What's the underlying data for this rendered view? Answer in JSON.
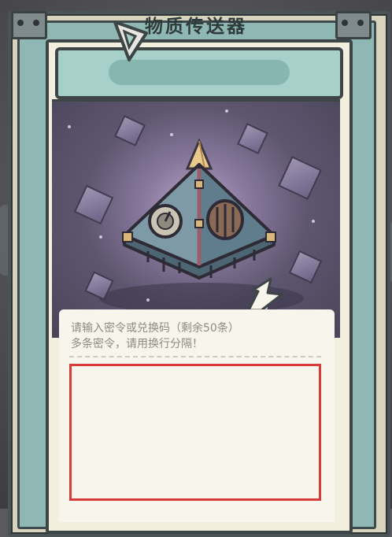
{
  "dialog": {
    "title": "物质传送器"
  },
  "input": {
    "hint_line1": "请输入密令或兑换码（剩余50条）",
    "hint_line2": "多条密令，请用换行分隔！",
    "value": "",
    "border_color": "#d83a3a"
  },
  "art": {
    "icon": "pyramid-teleporter-icon"
  },
  "colors": {
    "panel": "#f3efdf",
    "title_bar": "#a7d0cb",
    "frame": "#d8d3bd",
    "artwork_bg": "#5e5670"
  }
}
